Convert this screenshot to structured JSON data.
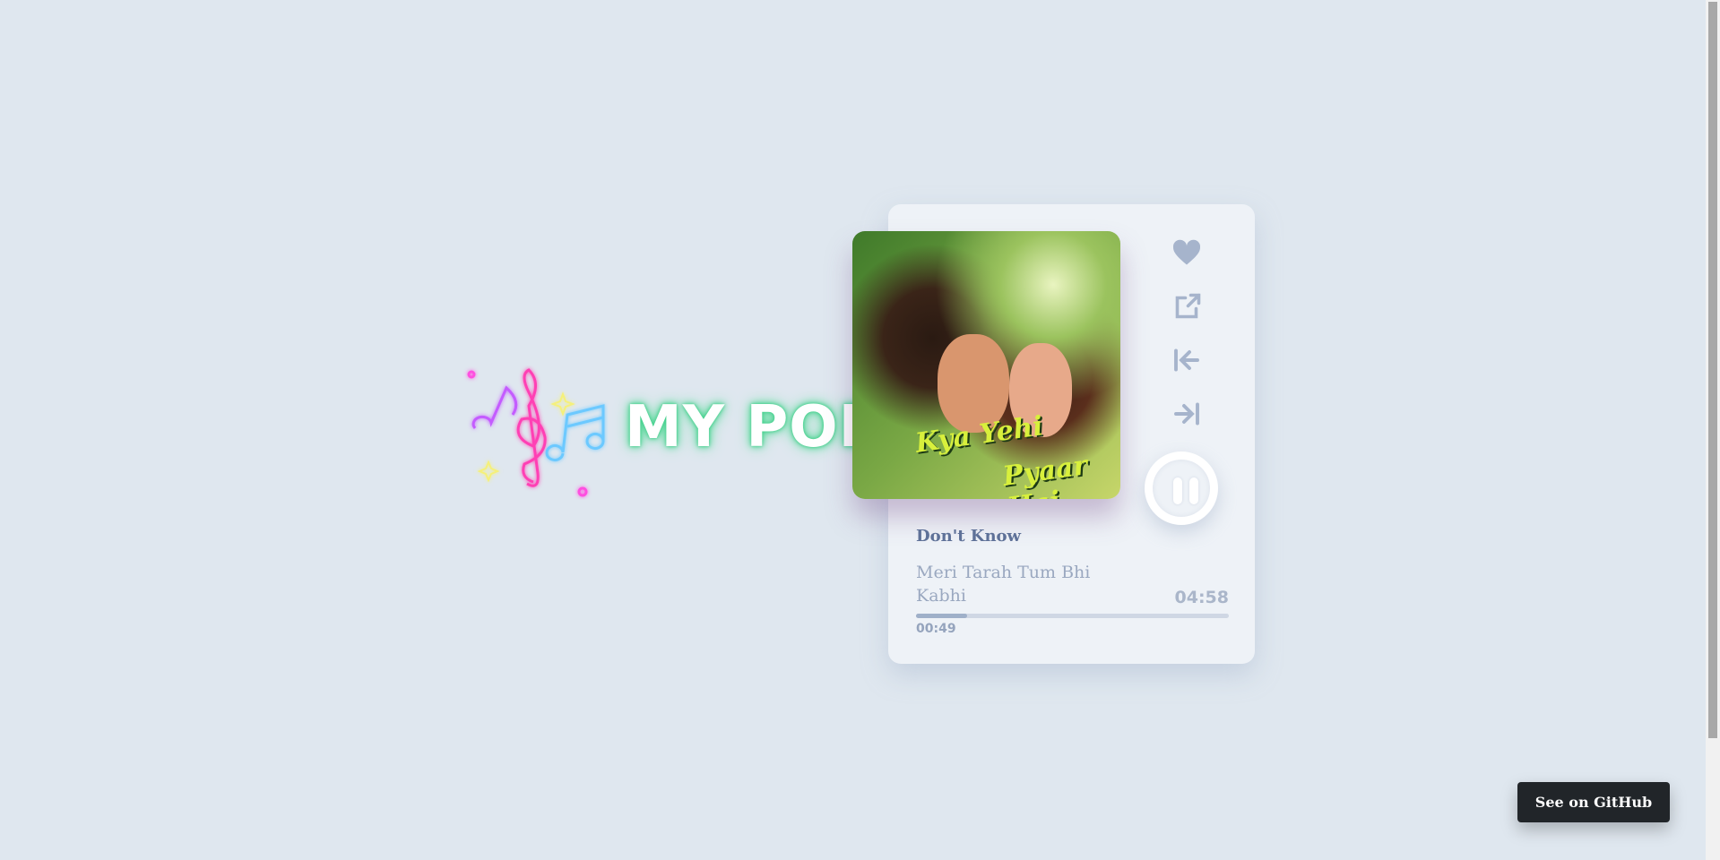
{
  "logo": {
    "text": "MY POD"
  },
  "player": {
    "album_art_text": [
      "Kya Yehi",
      "Pyaar Hai"
    ],
    "track_title": "Don't Know",
    "artist": "Meri Tarah Tum Bhi Kabhi",
    "duration": "04:58",
    "elapsed": "00:49",
    "progress_percent": 16.4,
    "state": "playing",
    "icons": [
      "heart-icon",
      "external-link-icon",
      "previous-track-icon",
      "next-track-icon",
      "pause-icon"
    ]
  },
  "github_button": {
    "label": "See on GitHub"
  },
  "colors": {
    "background": "#dfe7ef",
    "card": "#eef2f7",
    "icon": "#a6b4cc",
    "title": "#5e7198",
    "button": "#212529"
  }
}
